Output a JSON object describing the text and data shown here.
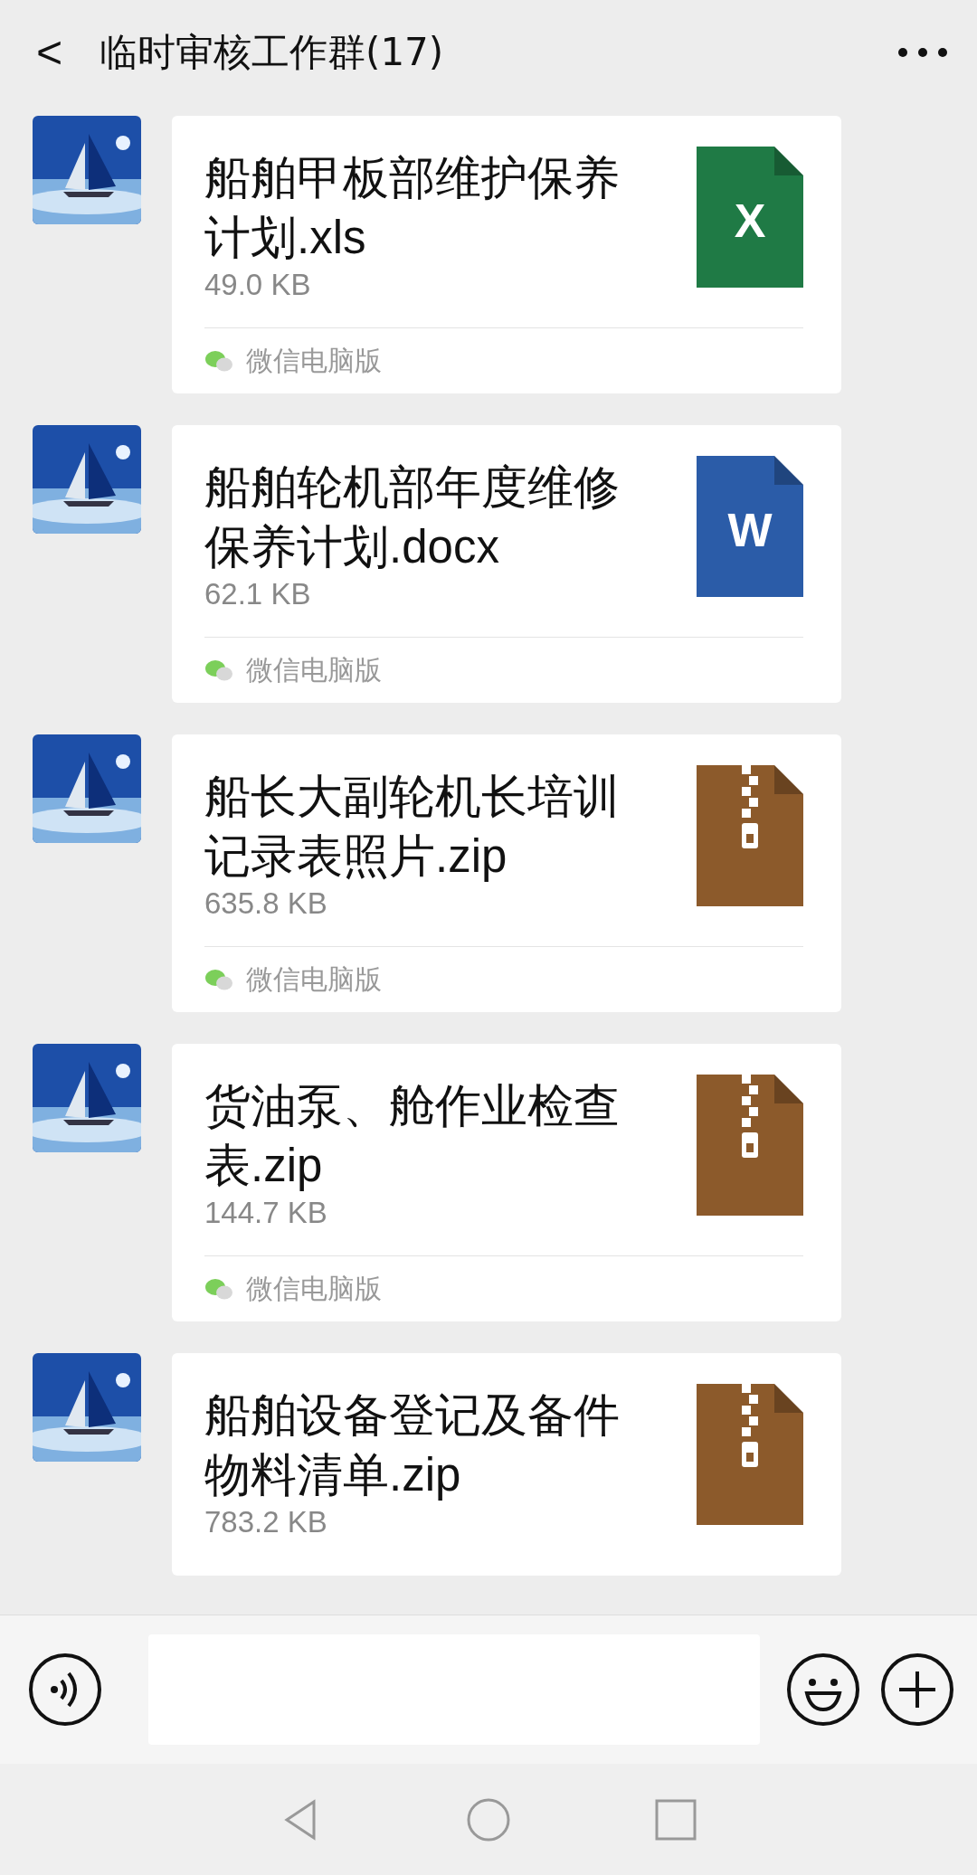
{
  "header": {
    "back": "<",
    "title": "临时审核工作群(17)"
  },
  "messages": [
    {
      "file_name": "船舶甲板部维护保养计划.xls",
      "size": "49.0 KB",
      "kind": "xls",
      "letter": "X",
      "source": "微信电脑版"
    },
    {
      "file_name": "船舶轮机部年度维修保养计划.docx",
      "size": "62.1 KB",
      "kind": "doc",
      "letter": "W",
      "source": "微信电脑版"
    },
    {
      "file_name": "船长大副轮机长培训记录表照片.zip",
      "size": "635.8 KB",
      "kind": "zip",
      "source": "微信电脑版"
    },
    {
      "file_name": "货油泵、舱作业检查表.zip",
      "size": "144.7 KB",
      "kind": "zip",
      "source": "微信电脑版"
    },
    {
      "file_name": "船舶设备登记及备件物料清单.zip",
      "size": "783.2 KB",
      "kind": "zip"
    }
  ]
}
